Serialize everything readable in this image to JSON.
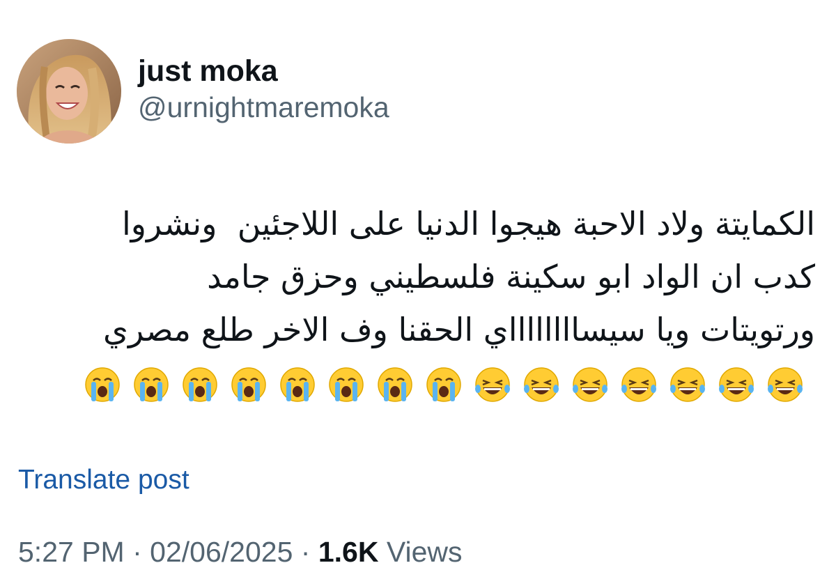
{
  "author": {
    "display_name": "just moka",
    "handle": "@urnightmaremoka",
    "avatar_icon": "profile-photo"
  },
  "post": {
    "lines": [
      "الكمايتة ولاد الاحبة هيجوا الدنيا على اللاجئين  ونشروا",
      "كدب ان الواد ابو سكينة فلسطيني وحزق جامد",
      "ورتويتات ويا سيسااااااااي الحقنا وف الاخر طلع مصري"
    ],
    "emojis": [
      "😭",
      "😭",
      "😭",
      "😭",
      "😭",
      "😭",
      "😭",
      "😭",
      "😂",
      "😂",
      "😂",
      "😂",
      "😂",
      "😂",
      "😂"
    ]
  },
  "translate_label": "Translate post",
  "meta": {
    "time": "5:27 PM",
    "separator": "·",
    "date": "02/06/2025",
    "views_count": "1.6K",
    "views_label": "Views"
  },
  "colors": {
    "text": "#0f1419",
    "secondary": "#536471",
    "link": "#1a5aa6"
  }
}
